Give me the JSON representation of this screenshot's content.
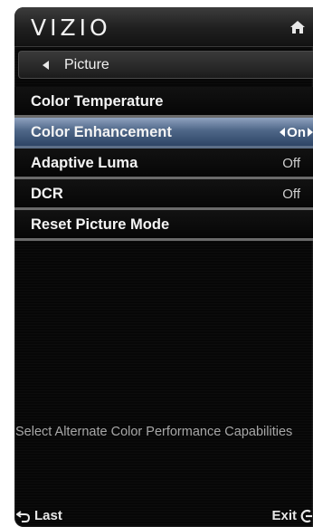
{
  "brand": "VIZIO",
  "nav": {
    "back_label": "Picture"
  },
  "menu": {
    "items": [
      {
        "label": "Color Temperature",
        "value": ""
      },
      {
        "label": "Color Enhancement",
        "value": "On"
      },
      {
        "label": "Adaptive Luma",
        "value": "Off"
      },
      {
        "label": "DCR",
        "value": "Off"
      },
      {
        "label": "Reset Picture Mode",
        "value": ""
      }
    ],
    "selected_index": 1
  },
  "help_text": "Select Alternate Color Performance Capabilities",
  "footer": {
    "last_label": "Last",
    "exit_label": "Exit"
  },
  "colors": {
    "selection": "#4f6788",
    "background": "#070707",
    "text": "#f4f4f4"
  },
  "icons": {
    "home": "home-icon",
    "back": "back-arrow-icon",
    "last": "return-arrow-icon",
    "exit": "exit-icon"
  }
}
